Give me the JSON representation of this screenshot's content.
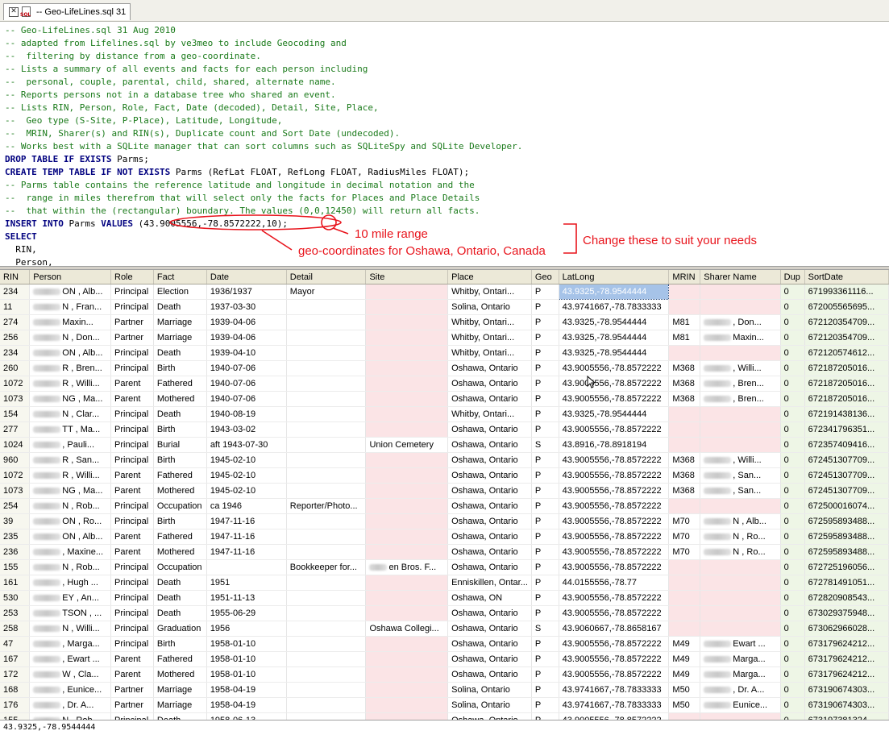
{
  "tab": {
    "title": "-- Geo-LifeLines.sql 31",
    "icon_label": "SQL"
  },
  "code_lines": [
    {
      "type": "cm",
      "text": "-- Geo-LifeLines.sql 31 Aug 2010"
    },
    {
      "type": "cm",
      "text": "-- adapted from Lifelines.sql by ve3meo to include Geocoding and"
    },
    {
      "type": "cm",
      "text": "--  filtering by distance from a geo-coordinate."
    },
    {
      "type": "cm",
      "text": "-- Lists a summary of all events and facts for each person including"
    },
    {
      "type": "cm",
      "text": "--  personal, couple, parental, child, shared, alternate name."
    },
    {
      "type": "cm",
      "text": "-- Reports persons not in a database tree who shared an event."
    },
    {
      "type": "cm",
      "text": "-- Lists RIN, Person, Role, Fact, Date (decoded), Detail, Site, Place,"
    },
    {
      "type": "cm",
      "text": "--  Geo type (S-Site, P-Place), Latitude, Longitude,"
    },
    {
      "type": "cm",
      "text": "--  MRIN, Sharer(s) and RIN(s), Duplicate count and Sort Date (undecoded)."
    },
    {
      "type": "cm",
      "text": "-- Works best with a SQLite manager that can sort columns such as SQLiteSpy and SQLite Developer."
    },
    {
      "type": "mixed",
      "kw": "DROP TABLE IF EXISTS",
      "rest": " Parms;"
    },
    {
      "type": "mixed",
      "kw": "CREATE TEMP TABLE IF NOT EXISTS",
      "rest": " Parms (RefLat FLOAT, RefLong FLOAT, RadiusMiles FLOAT);"
    },
    {
      "type": "cm",
      "text": "-- Parms table contains the reference latitude and longitude in decimal notation and the"
    },
    {
      "type": "cm",
      "text": "--  range in miles therefrom that will select only the facts for Places and Place Details"
    },
    {
      "type": "cm",
      "text": "--  that within the (rectangular) boundary. The values (0,0,12450) will return all facts."
    },
    {
      "type": "insert",
      "kw1": "INSERT INTO",
      "mid": " Parms ",
      "kw2": "VALUES",
      "rest": " (43.9005556,-78.8572222,10);"
    },
    {
      "type": "kwonly",
      "kw": "SELECT"
    },
    {
      "type": "plain",
      "text": "  RIN,"
    },
    {
      "type": "plain",
      "text": "  Person,"
    }
  ],
  "annotations": {
    "range": "10 mile range",
    "geo": "geo-coordinates for Oshawa, Ontario, Canada",
    "change": "Change these to suit your needs"
  },
  "grid": {
    "columns": [
      "RIN",
      "Person",
      "Role",
      "Fact",
      "Date",
      "Detail",
      "Site",
      "Place",
      "Geo",
      "LatLong",
      "MRIN",
      "Sharer Name",
      "Dup",
      "SortDate"
    ],
    "rows": [
      [
        "234",
        "ON , Alb...",
        "Principal",
        "Election",
        "1936/1937",
        "Mayor",
        "",
        "Whitby, Ontari...",
        "P",
        "43.9325,-78.9544444",
        "",
        "",
        "0",
        "671993361116..."
      ],
      [
        "11",
        "N , Fran...",
        "Principal",
        "Death",
        "1937-03-30",
        "",
        "",
        "Solina, Ontario",
        "P",
        "43.9741667,-78.7833333",
        "",
        "",
        "0",
        "672005565695..."
      ],
      [
        "274",
        "Maxin...",
        "Partner",
        "Marriage",
        "1939-04-06",
        "",
        "",
        "Whitby, Ontari...",
        "P",
        "43.9325,-78.9544444",
        "M81",
        ", Don...",
        "0",
        "672120354709..."
      ],
      [
        "256",
        "N , Don...",
        "Partner",
        "Marriage",
        "1939-04-06",
        "",
        "",
        "Whitby, Ontari...",
        "P",
        "43.9325,-78.9544444",
        "M81",
        "Maxin...",
        "0",
        "672120354709..."
      ],
      [
        "234",
        "ON , Alb...",
        "Principal",
        "Death",
        "1939-04-10",
        "",
        "",
        "Whitby, Ontari...",
        "P",
        "43.9325,-78.9544444",
        "",
        "",
        "0",
        "672120574612..."
      ],
      [
        "260",
        "R , Bren...",
        "Principal",
        "Birth",
        "1940-07-06",
        "",
        "",
        "Oshawa, Ontario",
        "P",
        "43.9005556,-78.8572222",
        "M368",
        ", Willi...",
        "0",
        "672187205016..."
      ],
      [
        "1072",
        "R , Willi...",
        "Parent",
        "Fathered",
        "1940-07-06",
        "",
        "",
        "Oshawa, Ontario",
        "P",
        "43.9005556,-78.8572222",
        "M368",
        ", Bren...",
        "0",
        "672187205016..."
      ],
      [
        "1073",
        "NG , Ma...",
        "Parent",
        "Mothered",
        "1940-07-06",
        "",
        "",
        "Oshawa, Ontario",
        "P",
        "43.9005556,-78.8572222",
        "M368",
        ", Bren...",
        "0",
        "672187205016..."
      ],
      [
        "154",
        "N , Clar...",
        "Principal",
        "Death",
        "1940-08-19",
        "",
        "",
        "Whitby, Ontari...",
        "P",
        "43.9325,-78.9544444",
        "",
        "",
        "0",
        "672191438136..."
      ],
      [
        "277",
        "TT , Ma...",
        "Principal",
        "Birth",
        "1943-03-02",
        "",
        "",
        "Oshawa, Ontario",
        "P",
        "43.9005556,-78.8572222",
        "",
        "",
        "0",
        "672341796351..."
      ],
      [
        "1024",
        ", Pauli...",
        "Principal",
        "Burial",
        "aft 1943-07-30",
        "",
        "Union Cemetery",
        "Oshawa, Ontario",
        "S",
        "43.8916,-78.8918194",
        "",
        "",
        "0",
        "672357409416..."
      ],
      [
        "960",
        "R , San...",
        "Principal",
        "Birth",
        "1945-02-10",
        "",
        "",
        "Oshawa, Ontario",
        "P",
        "43.9005556,-78.8572222",
        "M368",
        ", Willi...",
        "0",
        "672451307709..."
      ],
      [
        "1072",
        "R , Willi...",
        "Parent",
        "Fathered",
        "1945-02-10",
        "",
        "",
        "Oshawa, Ontario",
        "P",
        "43.9005556,-78.8572222",
        "M368",
        ", San...",
        "0",
        "672451307709..."
      ],
      [
        "1073",
        "NG , Ma...",
        "Parent",
        "Mothered",
        "1945-02-10",
        "",
        "",
        "Oshawa, Ontario",
        "P",
        "43.9005556,-78.8572222",
        "M368",
        ", San...",
        "0",
        "672451307709..."
      ],
      [
        "254",
        "N , Rob...",
        "Principal",
        "Occupation",
        "ca 1946",
        "Reporter/Photo...",
        "",
        "Oshawa, Ontario",
        "P",
        "43.9005556,-78.8572222",
        "",
        "",
        "0",
        "672500016074..."
      ],
      [
        "39",
        "ON , Ro...",
        "Principal",
        "Birth",
        "1947-11-16",
        "",
        "",
        "Oshawa, Ontario",
        "P",
        "43.9005556,-78.8572222",
        "M70",
        "N , Alb...",
        "0",
        "672595893488..."
      ],
      [
        "235",
        "ON , Alb...",
        "Parent",
        "Fathered",
        "1947-11-16",
        "",
        "",
        "Oshawa, Ontario",
        "P",
        "43.9005556,-78.8572222",
        "M70",
        "N , Ro...",
        "0",
        "672595893488..."
      ],
      [
        "236",
        ", Maxine...",
        "Parent",
        "Mothered",
        "1947-11-16",
        "",
        "",
        "Oshawa, Ontario",
        "P",
        "43.9005556,-78.8572222",
        "M70",
        "N , Ro...",
        "0",
        "672595893488..."
      ],
      [
        "155",
        "N , Rob...",
        "Principal",
        "Occupation",
        "",
        "Bookkeeper for...",
        "en Bros. F...",
        "Oshawa, Ontario",
        "P",
        "43.9005556,-78.8572222",
        "",
        "",
        "0",
        "672725196056..."
      ],
      [
        "161",
        ", Hugh ...",
        "Principal",
        "Death",
        "1951",
        "",
        "",
        "Enniskillen, Ontar...",
        "P",
        "44.0155556,-78.77",
        "",
        "",
        "0",
        "672781491051..."
      ],
      [
        "530",
        "EY , An...",
        "Principal",
        "Death",
        "1951-11-13",
        "",
        "",
        "Oshawa, ON",
        "P",
        "43.9005556,-78.8572222",
        "",
        "",
        "0",
        "672820908543..."
      ],
      [
        "253",
        "TSON , ...",
        "Principal",
        "Death",
        "1955-06-29",
        "",
        "",
        "Oshawa, Ontario",
        "P",
        "43.9005556,-78.8572222",
        "",
        "",
        "0",
        "673029375948..."
      ],
      [
        "258",
        "N , Willi...",
        "Principal",
        "Graduation",
        "1956",
        "",
        "Oshawa Collegi...",
        "Oshawa, Ontario",
        "S",
        "43.9060667,-78.8658167",
        "",
        "",
        "0",
        "673062966028..."
      ],
      [
        "47",
        ", Marga...",
        "Principal",
        "Birth",
        "1958-01-10",
        "",
        "",
        "Oshawa, Ontario",
        "P",
        "43.9005556,-78.8572222",
        "M49",
        "Ewart ...",
        "0",
        "673179624212..."
      ],
      [
        "167",
        ", Ewart ...",
        "Parent",
        "Fathered",
        "1958-01-10",
        "",
        "",
        "Oshawa, Ontario",
        "P",
        "43.9005556,-78.8572222",
        "M49",
        "Marga...",
        "0",
        "673179624212..."
      ],
      [
        "172",
        "W , Cla...",
        "Parent",
        "Mothered",
        "1958-01-10",
        "",
        "",
        "Oshawa, Ontario",
        "P",
        "43.9005556,-78.8572222",
        "M49",
        "Marga...",
        "0",
        "673179624212..."
      ],
      [
        "168",
        ", Eunice...",
        "Partner",
        "Marriage",
        "1958-04-19",
        "",
        "",
        "Solina, Ontario",
        "P",
        "43.9741667,-78.7833333",
        "M50",
        ", Dr. A...",
        "0",
        "673190674303..."
      ],
      [
        "176",
        ", Dr. A...",
        "Partner",
        "Marriage",
        "1958-04-19",
        "",
        "",
        "Solina, Ontario",
        "P",
        "43.9741667,-78.7833333",
        "M50",
        "Eunice...",
        "0",
        "673190674303..."
      ],
      [
        "155",
        "N , Rob...",
        "Principal",
        "Death",
        "1958-06-13",
        "",
        "",
        "Oshawa, Ontario",
        "P",
        "43.9005556,-78.8572222",
        "",
        "",
        "0",
        "673197381324..."
      ],
      [
        "173",
        ", James...",
        "Principal",
        "Birth",
        "1959-01-03",
        "",
        "",
        "Oshawa, Ontario",
        "P",
        "43.9005556,-78.8572222",
        "M49",
        "Ewart ...",
        "0",
        "673235534378..."
      ]
    ],
    "selected": {
      "row": 0,
      "col": 9
    }
  },
  "status": {
    "text": "43.9325,-78.9544444"
  }
}
